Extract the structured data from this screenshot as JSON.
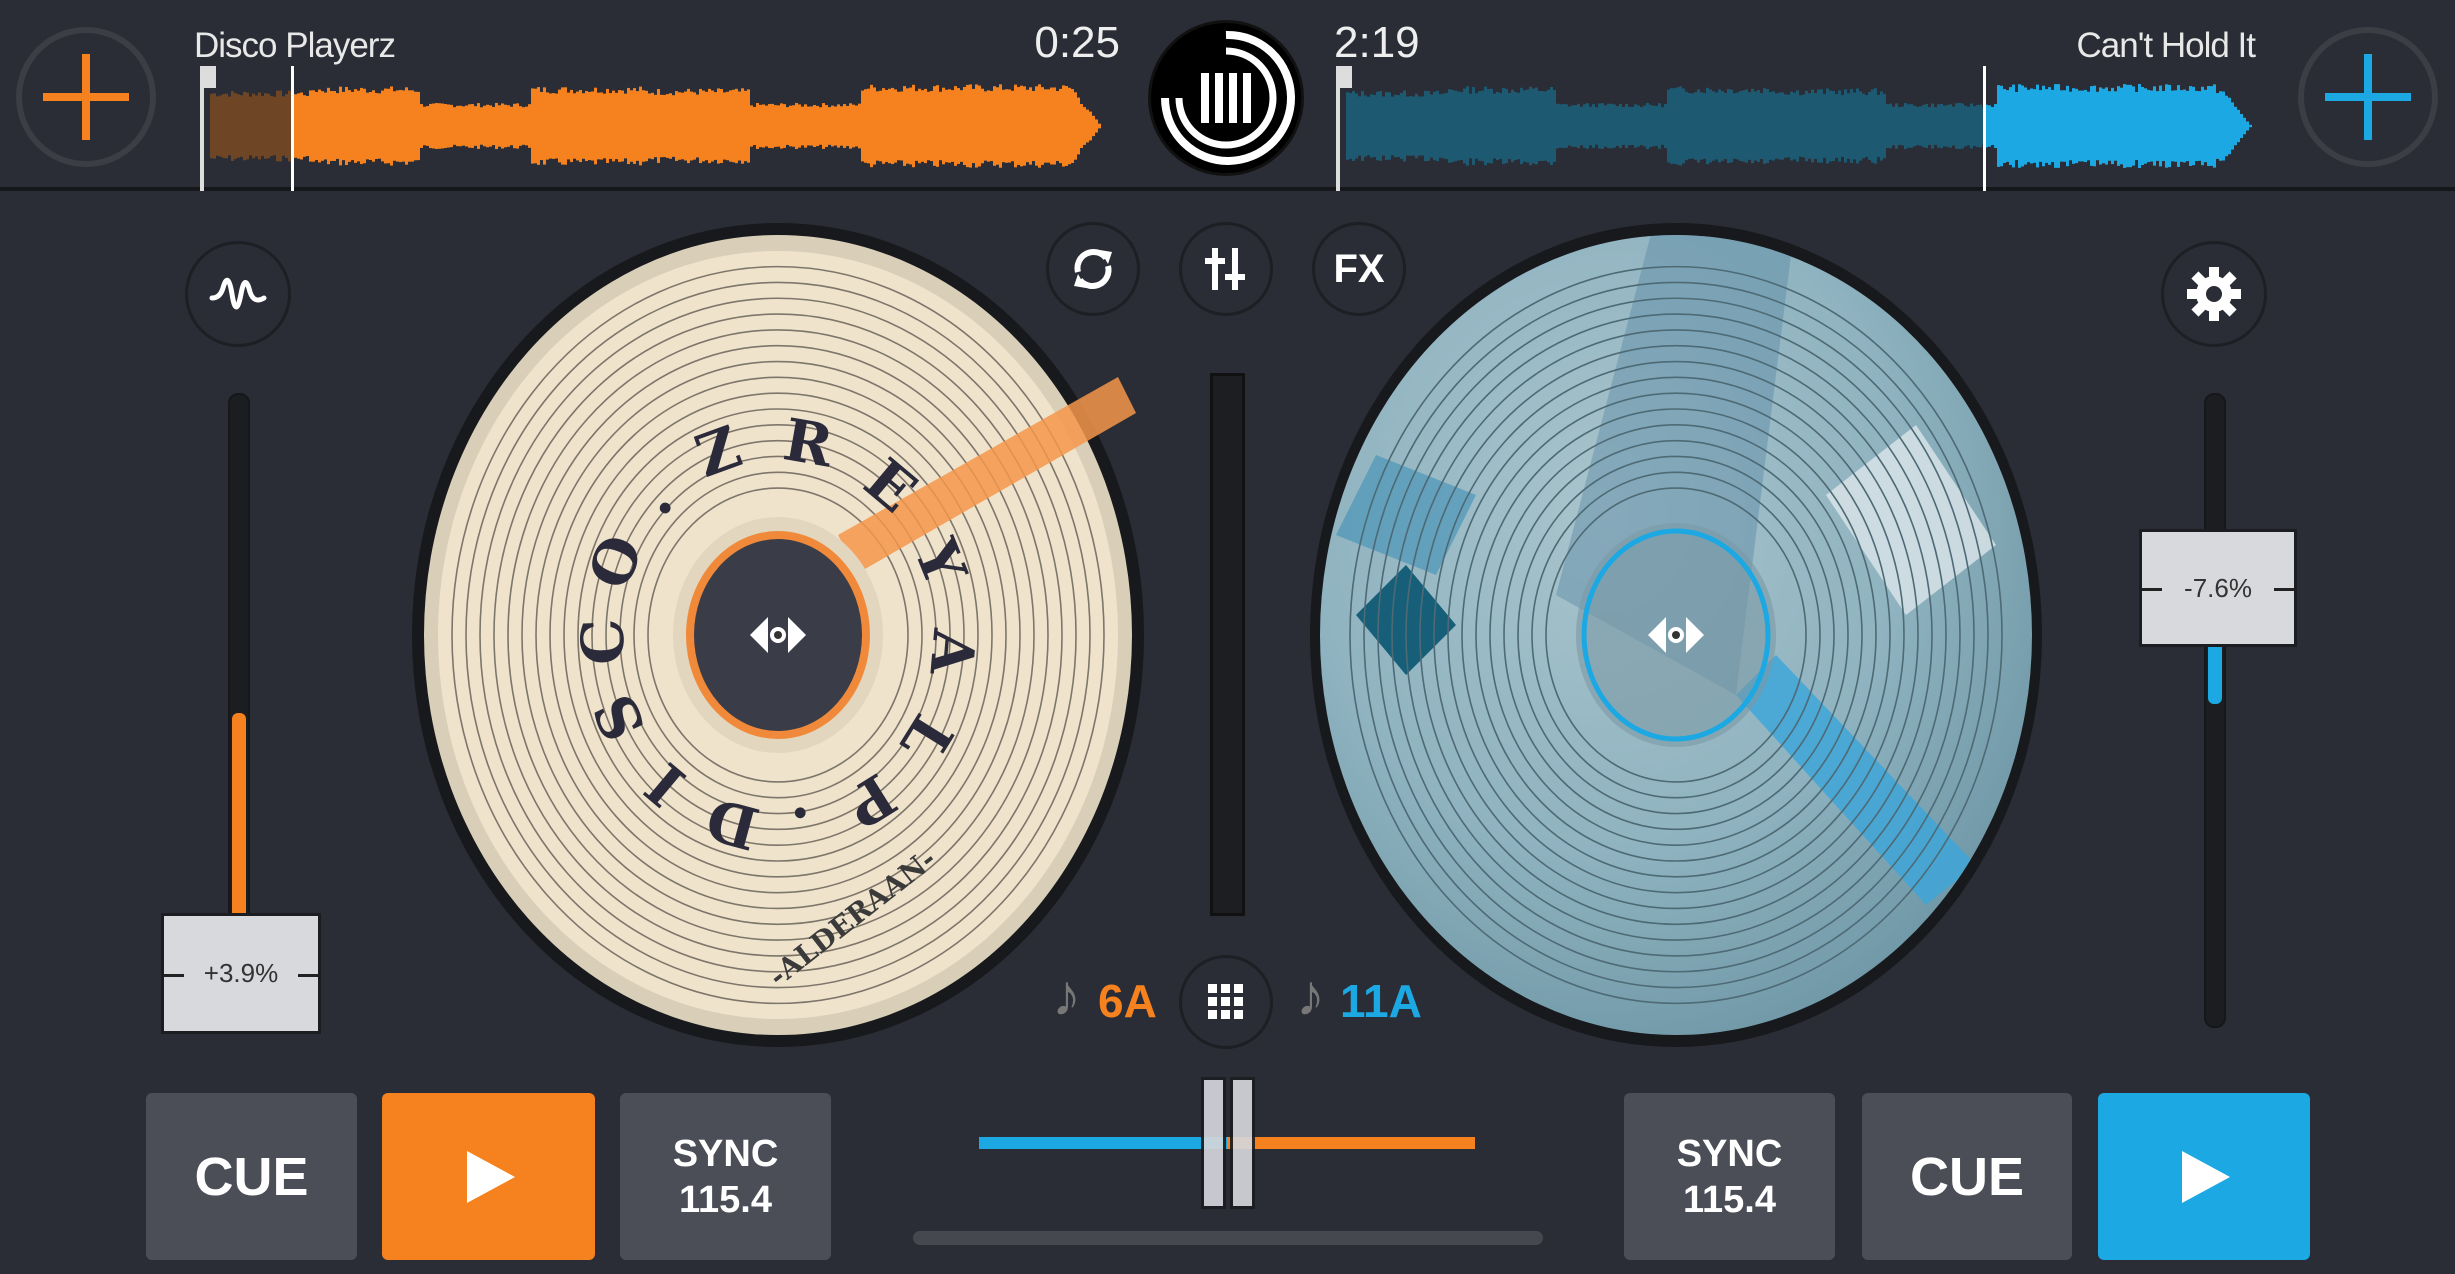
{
  "colors": {
    "background": "#2a2d35",
    "deck_a": "#f5821f",
    "deck_b": "#1ca8e3",
    "button": "#4b4e56"
  },
  "top_bar": {
    "deck_a": {
      "add_icon": "plus-icon",
      "track_title": "Disco Playerz",
      "elapsed": "0:25",
      "progress": 0.1
    },
    "deck_b": {
      "add_icon": "plus-icon",
      "track_title": "Can't Hold It",
      "remaining": "2:19",
      "progress": 0.7
    },
    "logo_icon": "app-logo"
  },
  "center": {
    "buttons": [
      {
        "name": "loop",
        "icon": "loop-icon"
      },
      {
        "name": "mixer",
        "icon": "sliders-icon"
      },
      {
        "name": "fx",
        "label": "FX"
      }
    ],
    "pads_icon": "grid-icon",
    "deck_a_key": "6A",
    "deck_b_key": "11A",
    "note_icon": "music-note-icon",
    "crossfader_position": 0.5
  },
  "deck_a": {
    "side_icon": "waveform-icon",
    "pitch_label": "+3.9%",
    "pitch_percent": 3.9,
    "platter_art_text": [
      "D",
      "I",
      "S",
      "C",
      "O",
      ".",
      "Z",
      "R",
      "E",
      "Y",
      "A",
      "L",
      "P",
      ".",
      "ALDERAAN"
    ],
    "cue_label": "CUE",
    "play_icon": "play-icon",
    "sync_label": "SYNC",
    "bpm": "115.4"
  },
  "deck_b": {
    "side_icon": "gear-icon",
    "pitch_label": "-7.6%",
    "pitch_percent": -7.6,
    "cue_label": "CUE",
    "play_icon": "play-icon",
    "sync_label": "SYNC",
    "bpm": "115.4"
  }
}
